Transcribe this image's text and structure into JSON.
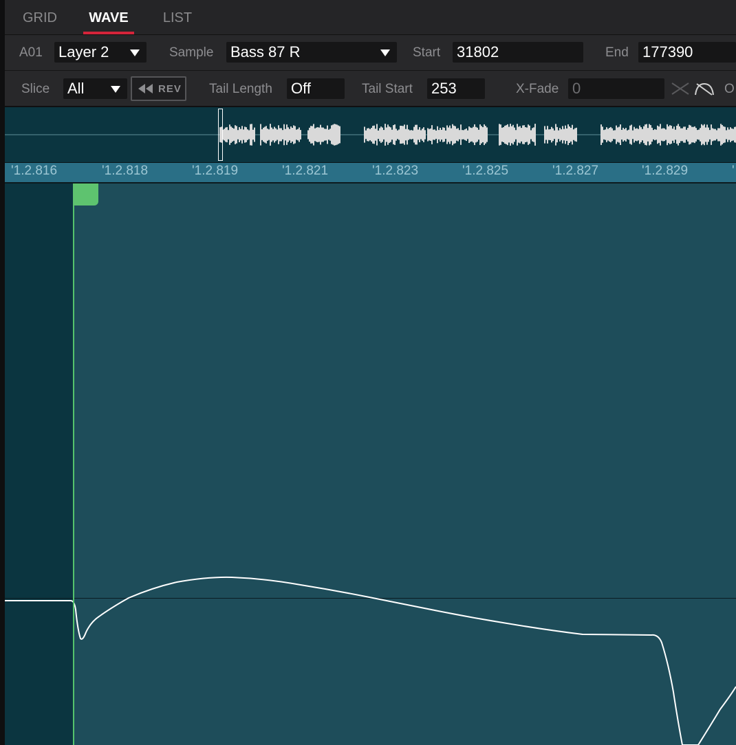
{
  "tabs": [
    {
      "label": "GRID",
      "active": false
    },
    {
      "label": "WAVE",
      "active": true
    },
    {
      "label": "LIST",
      "active": false
    }
  ],
  "layer": {
    "pad": "A01",
    "value": "Layer 2"
  },
  "sample": {
    "label": "Sample",
    "value": "Bass 87 R"
  },
  "start": {
    "label": "Start",
    "value": "31802"
  },
  "end": {
    "label": "End",
    "value": "177390"
  },
  "slice": {
    "label": "Slice",
    "value": "All"
  },
  "rev_button": {
    "label": "REV",
    "icon": "rewind-icon"
  },
  "tail_length": {
    "label": "Tail Length",
    "value": "Off"
  },
  "tail_start": {
    "label": "Tail Start",
    "value": "253"
  },
  "xfade": {
    "label": "X-Fade",
    "value": "0",
    "icons": [
      "linear-crossfade-icon",
      "curved-crossfade-icon"
    ],
    "cut_label": "O"
  },
  "ruler_ticks": [
    "'1.2.816",
    "'1.2.818",
    "'1.2.819",
    "'1.2.821",
    "'1.2.823",
    "'1.2.825",
    "'1.2.827",
    "'1.2.829",
    "'"
  ],
  "colors": {
    "accent_red": "#d4243a",
    "start_marker": "#5ec36f",
    "waveform": "#ffffff",
    "wave_bg": "#1e4d5a",
    "overview_bg": "#0b3540",
    "ruler_bg": "#2a6f86"
  }
}
